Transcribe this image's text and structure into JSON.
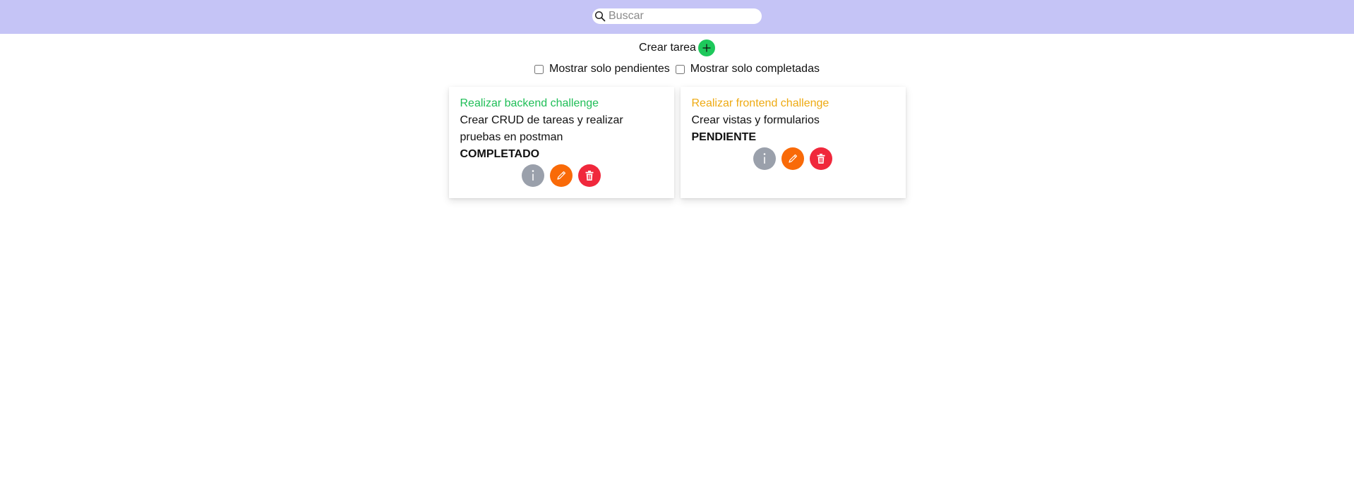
{
  "search": {
    "placeholder": "Buscar",
    "value": ""
  },
  "create": {
    "label": "Crear tarea"
  },
  "filters": {
    "pending_label": "Mostrar solo pendientes",
    "completed_label": "Mostrar solo completadas"
  },
  "colors": {
    "header_bg": "#c5c4f6",
    "completed_title": "#1fbe57",
    "pending_title": "#eeaa12",
    "add_button": "#1ec85b",
    "info_button": "#9aa0ab",
    "edit_button": "#f96a08",
    "delete_button": "#f0283c"
  },
  "tasks": [
    {
      "title": "Realizar backend challenge",
      "description": "Crear CRUD de tareas y realizar pruebas en postman",
      "status": "COMPLETADO"
    },
    {
      "title": "Realizar frontend challenge",
      "description": "Crear vistas y formularios",
      "status": "PENDIENTE"
    }
  ],
  "icons": {
    "search": "search-icon",
    "add": "plus-icon",
    "info": "info-icon",
    "edit": "pencil-icon",
    "delete": "trash-icon"
  }
}
